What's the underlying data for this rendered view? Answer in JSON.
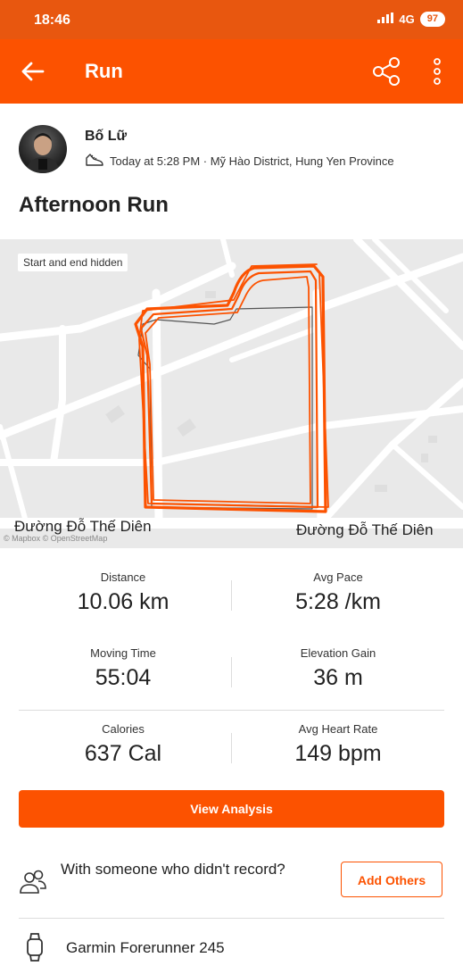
{
  "status_bar": {
    "time": "18:46",
    "network": "4G",
    "battery": "97"
  },
  "app_bar": {
    "title": "Run"
  },
  "athlete": {
    "name": "Bố Lữ",
    "meta": "Today at 5:28 PM · Mỹ Hào District, Hung Yen Province"
  },
  "activity": {
    "title": "Afternoon Run"
  },
  "map": {
    "note": "Start and end hidden",
    "street_left": "Đường Đỗ Thế Diên",
    "street_right": "Đường Đỗ Thế Diên",
    "attribution": "© Mapbox © OpenStreetMap",
    "route_color": "#fc5200"
  },
  "stats": [
    {
      "label": "Distance",
      "value": "10.06 km"
    },
    {
      "label": "Avg Pace",
      "value": "5:28 /km"
    },
    {
      "label": "Moving Time",
      "value": "55:04"
    },
    {
      "label": "Elevation Gain",
      "value": "36 m"
    },
    {
      "label": "Calories",
      "value": "637 Cal"
    },
    {
      "label": "Avg Heart Rate",
      "value": "149 bpm"
    }
  ],
  "actions": {
    "view_analysis": "View Analysis",
    "add_others": "Add Others"
  },
  "others": {
    "prompt": "With someone who didn't record?"
  },
  "device": {
    "name": "Garmin Forerunner 245"
  },
  "colors": {
    "brand": "#fc5200",
    "status": "#e8570f"
  }
}
